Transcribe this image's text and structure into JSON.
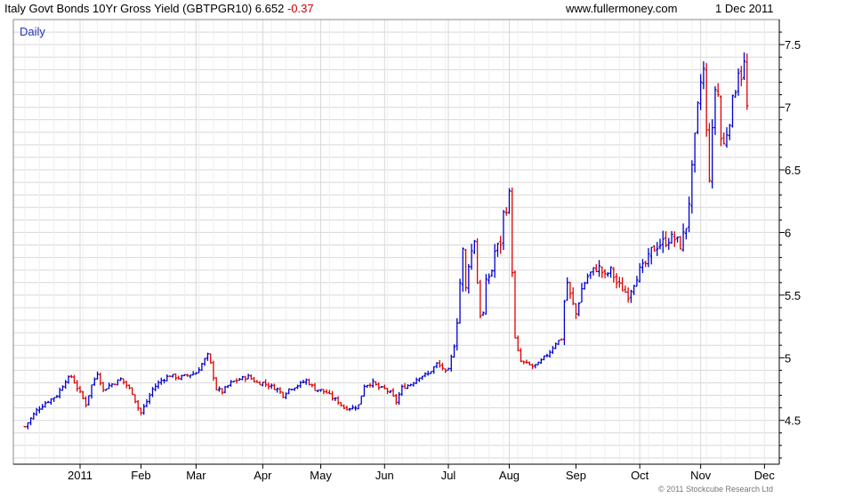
{
  "header": {
    "title": "Italy Govt Bonds 10Yr Gross Yield (GBTPGR10) 6.652",
    "change": "-0.37",
    "website": "www.fullermoney.com",
    "date": "1 Dec 2011"
  },
  "footer": {
    "copyright": "© 2011 Stockcube Research Ltd"
  },
  "colors": {
    "up": "#0000cc",
    "down": "#dd0000",
    "grid": "#d8d8d8",
    "frame": "#888888"
  },
  "chart_data": {
    "type": "ohlc",
    "period_label": "Daily",
    "x_tick_labels": [
      "2011",
      "Feb",
      "Mar",
      "Apr",
      "May",
      "Jun",
      "Jul",
      "Aug",
      "Sep",
      "Oct",
      "Nov",
      "Dec"
    ],
    "x_tick_positions_weekday_index": [
      0,
      21,
      40,
      63,
      83,
      105,
      127,
      148,
      171,
      193,
      214,
      236
    ],
    "y_tick_labels": [
      "4.5",
      "5",
      "5.5",
      "6",
      "6.5",
      "7",
      "7.5"
    ],
    "y_ticks": [
      4.5,
      5.0,
      5.5,
      6.0,
      6.5,
      7.0,
      7.5
    ],
    "ylim": [
      4.15,
      7.7
    ],
    "grid": true,
    "y_axis_side": "right",
    "days_before_first_label": 19,
    "x_unit": "trading day",
    "series": [
      {
        "values": [
          [
            -19,
            4.45
          ],
          [
            -15,
            4.58
          ],
          [
            -12,
            4.64
          ],
          [
            -8,
            4.7
          ],
          [
            -5,
            4.82
          ],
          [
            -3,
            4.85
          ],
          [
            -1,
            4.76
          ],
          [
            0,
            4.72
          ],
          [
            2,
            4.63
          ],
          [
            4,
            4.78
          ],
          [
            6,
            4.88
          ],
          [
            8,
            4.74
          ],
          [
            10,
            4.78
          ],
          [
            12,
            4.8
          ],
          [
            14,
            4.83
          ],
          [
            16,
            4.78
          ],
          [
            18,
            4.72
          ],
          [
            20,
            4.6
          ],
          [
            21,
            4.56
          ],
          [
            23,
            4.65
          ],
          [
            25,
            4.75
          ],
          [
            28,
            4.82
          ],
          [
            31,
            4.86
          ],
          [
            34,
            4.84
          ],
          [
            37,
            4.86
          ],
          [
            40,
            4.88
          ],
          [
            42,
            4.95
          ],
          [
            44,
            5.02
          ],
          [
            45,
            4.95
          ],
          [
            46,
            4.85
          ],
          [
            47,
            4.75
          ],
          [
            49,
            4.73
          ],
          [
            52,
            4.8
          ],
          [
            55,
            4.83
          ],
          [
            58,
            4.85
          ],
          [
            61,
            4.8
          ],
          [
            63,
            4.8
          ],
          [
            65,
            4.78
          ],
          [
            68,
            4.75
          ],
          [
            70,
            4.7
          ],
          [
            72,
            4.75
          ],
          [
            75,
            4.78
          ],
          [
            78,
            4.82
          ],
          [
            81,
            4.75
          ],
          [
            83,
            4.74
          ],
          [
            85,
            4.72
          ],
          [
            87,
            4.68
          ],
          [
            89,
            4.65
          ],
          [
            91,
            4.6
          ],
          [
            94,
            4.6
          ],
          [
            96,
            4.62
          ],
          [
            98,
            4.78
          ],
          [
            101,
            4.8
          ],
          [
            103,
            4.76
          ],
          [
            105,
            4.75
          ],
          [
            107,
            4.72
          ],
          [
            109,
            4.65
          ],
          [
            111,
            4.76
          ],
          [
            114,
            4.79
          ],
          [
            117,
            4.85
          ],
          [
            120,
            4.87
          ],
          [
            123,
            4.95
          ],
          [
            125,
            4.92
          ],
          [
            126,
            4.88
          ],
          [
            127,
            4.9
          ],
          [
            129,
            5.1
          ],
          [
            130,
            5.3
          ],
          [
            131,
            5.6
          ],
          [
            132,
            5.85
          ],
          [
            133,
            5.55
          ],
          [
            134,
            5.75
          ],
          [
            136,
            5.95
          ],
          [
            137,
            5.6
          ],
          [
            138,
            5.35
          ],
          [
            139,
            5.35
          ],
          [
            140,
            5.6
          ],
          [
            142,
            5.7
          ],
          [
            143,
            5.85
          ],
          [
            145,
            5.92
          ],
          [
            146,
            6.15
          ],
          [
            147,
            6.2
          ],
          [
            148,
            6.3
          ],
          [
            149,
            5.7
          ],
          [
            150,
            5.15
          ],
          [
            151,
            5.05
          ],
          [
            152,
            4.97
          ],
          [
            154,
            4.95
          ],
          [
            156,
            4.93
          ],
          [
            158,
            4.95
          ],
          [
            160,
            5.0
          ],
          [
            162,
            5.05
          ],
          [
            164,
            5.12
          ],
          [
            166,
            5.15
          ],
          [
            167,
            5.45
          ],
          [
            168,
            5.6
          ],
          [
            169,
            5.5
          ],
          [
            171,
            5.35
          ],
          [
            173,
            5.55
          ],
          [
            175,
            5.65
          ],
          [
            177,
            5.7
          ],
          [
            179,
            5.72
          ],
          [
            181,
            5.65
          ],
          [
            183,
            5.7
          ],
          [
            185,
            5.6
          ],
          [
            187,
            5.55
          ],
          [
            189,
            5.5
          ],
          [
            191,
            5.6
          ],
          [
            193,
            5.7
          ],
          [
            195,
            5.75
          ],
          [
            197,
            5.85
          ],
          [
            199,
            5.9
          ],
          [
            201,
            5.92
          ],
          [
            203,
            5.95
          ],
          [
            205,
            5.95
          ],
          [
            207,
            5.9
          ],
          [
            209,
            6.05
          ],
          [
            210,
            6.25
          ],
          [
            211,
            6.5
          ],
          [
            212,
            6.75
          ],
          [
            213,
            7.0
          ],
          [
            214,
            7.2
          ],
          [
            215,
            7.3
          ],
          [
            216,
            6.8
          ],
          [
            217,
            6.45
          ],
          [
            218,
            6.8
          ],
          [
            219,
            7.15
          ],
          [
            220,
            7.1
          ],
          [
            221,
            6.75
          ],
          [
            222,
            6.7
          ],
          [
            223,
            6.8
          ],
          [
            224,
            6.9
          ],
          [
            225,
            7.05
          ],
          [
            226,
            7.15
          ],
          [
            227,
            7.3
          ],
          [
            228,
            7.25
          ],
          [
            229,
            7.35
          ],
          [
            230,
            7.0
          ],
          [
            231,
            6.7
          ]
        ]
      }
    ]
  }
}
